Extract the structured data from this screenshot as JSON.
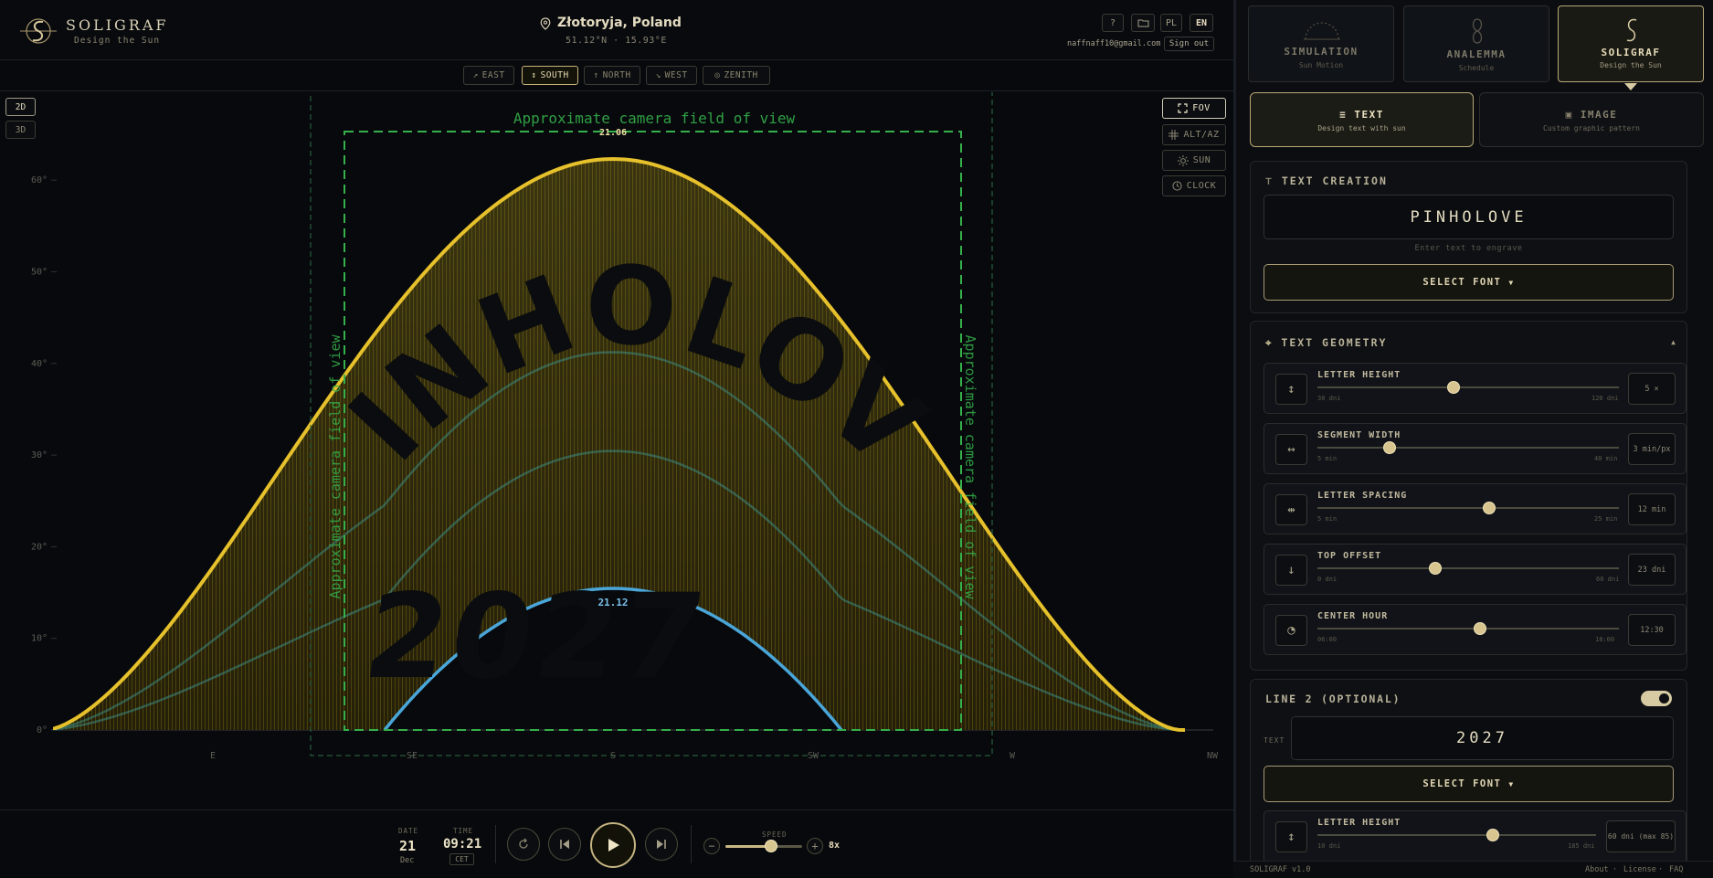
{
  "header": {
    "brand": "SOLIGRAF",
    "tagline": "Design the Sun",
    "location": "Złotoryja, Poland",
    "coordinates": "51.12°N · 15.93°E",
    "help_label": "?",
    "lang_pl": "PL",
    "lang_en": "EN",
    "email": "naffnaff10@gmail.com",
    "sign_out": "Sign out"
  },
  "views": [
    {
      "icon": "↗",
      "label": "EAST",
      "active": false
    },
    {
      "icon": "↕",
      "label": "SOUTH",
      "active": true
    },
    {
      "icon": "↑",
      "label": "NORTH",
      "active": false
    },
    {
      "icon": "↘",
      "label": "WEST",
      "active": false
    },
    {
      "icon": "◎",
      "label": "ZENITH",
      "active": false
    }
  ],
  "modes": {
    "twod": "2D",
    "threed": "3D"
  },
  "overlays": [
    {
      "label": "FOV",
      "active": true,
      "icon": "expand-icon"
    },
    {
      "label": "ALT/AZ",
      "active": false,
      "icon": "grid-icon"
    },
    {
      "label": "SUN",
      "active": false,
      "icon": "sun-icon"
    },
    {
      "label": "CLOCK",
      "active": false,
      "icon": "clock-icon"
    }
  ],
  "chart": {
    "fov_label": "Approximate camera field of view",
    "date_top": "21.06",
    "date_bottom": "21.12",
    "text_line1": "PINHOLOVE",
    "text_line2": "2027",
    "y_ticks": [
      "0°",
      "10°",
      "20°",
      "30°",
      "40°",
      "50°",
      "60°"
    ],
    "x_ticks": [
      "E",
      "SE",
      "S",
      "SW",
      "W",
      "NW"
    ],
    "colors": {
      "summer": "#e6c12c",
      "winter": "#4aa6d8",
      "fov": "#35b04a"
    }
  },
  "playback": {
    "date_label": "DATE",
    "date_day": "21",
    "date_month": "Dec",
    "time_label": "TIME",
    "time_value": "09:21",
    "timezone": "CET",
    "speed_label": "SPEED",
    "speed_value": "8x",
    "speed_fraction": 0.6
  },
  "panel": {
    "modes": [
      {
        "title": "SIMULATION",
        "subtitle": "Sun Motion",
        "active": false
      },
      {
        "title": "ANALEMMA",
        "subtitle": "Schedule",
        "active": false
      },
      {
        "title": "SOLIGRAF",
        "subtitle": "Design the Sun",
        "active": true
      }
    ],
    "tabs": [
      {
        "title": "TEXT",
        "subtitle": "Design text with sun",
        "active": true
      },
      {
        "title": "IMAGE",
        "subtitle": "Custom graphic pattern",
        "active": false
      }
    ],
    "text_creation": {
      "heading": "TEXT CREATION",
      "value": "PINHOLOVE",
      "hint": "Enter text to engrave",
      "font_button": "SELECT FONT"
    },
    "geometry": {
      "heading": "TEXT GEOMETRY",
      "sliders": [
        {
          "label": "LETTER HEIGHT",
          "min": "30 dni",
          "max": "120 dni",
          "value": "5 ×",
          "fraction": 0.45
        },
        {
          "label": "SEGMENT WIDTH",
          "min": "5 min",
          "max": "40 min",
          "value": "3 min/px",
          "fraction": 0.24
        },
        {
          "label": "LETTER SPACING",
          "min": "5 min",
          "max": "25 min",
          "value": "12 min",
          "fraction": 0.57
        },
        {
          "label": "TOP OFFSET",
          "min": "0 dni",
          "max": "60 dni",
          "value": "23 dni",
          "fraction": 0.39
        },
        {
          "label": "CENTER HOUR",
          "min": "06:00",
          "max": "18:00",
          "value": "12:30",
          "fraction": 0.54
        }
      ]
    },
    "line2": {
      "heading": "LINE 2 (OPTIONAL)",
      "enabled": true,
      "text_label": "TEXT",
      "value": "2027",
      "font_button": "SELECT FONT",
      "slider": {
        "label": "LETTER HEIGHT",
        "min": "10 dni",
        "max": "185 dni",
        "value": "60 dni (max 85)",
        "fraction": 0.63
      }
    },
    "footer": {
      "version": "SOLIGRAF v1.0",
      "links": [
        "About",
        "License",
        "FAQ"
      ]
    }
  }
}
